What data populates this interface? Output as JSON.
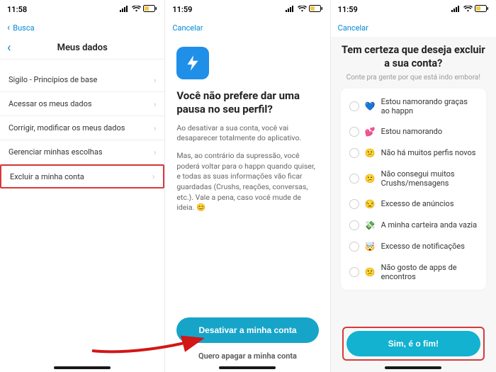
{
  "status": {
    "time1": "11:58",
    "time2": "11:59",
    "time3": "11:59",
    "busca": "Busca"
  },
  "colors": {
    "accent": "#17a4c9",
    "link": "#0088d4",
    "highlight": "#d83a3a"
  },
  "screen1": {
    "title": "Meus dados",
    "rows": [
      {
        "label": "Sigilo - Princípios de base"
      },
      {
        "label": "Acessar os meus dados"
      },
      {
        "label": "Corrigir, modificar os meus dados"
      },
      {
        "label": "Gerenciar minhas escolhas"
      },
      {
        "label": "Excluir a minha conta"
      }
    ]
  },
  "screen2": {
    "cancel": "Cancelar",
    "title": "Você não prefere dar uma pausa no seu perfil?",
    "p1": "Ao desativar a sua conta, você vai desaparecer totalmente do aplicativo.",
    "p2": "Mas, ao contrário da supressão, você poderá voltar para o happn quando quiser, e todas as suas informações vão ficar guardadas (Crushs, reações, conversas, etc.). Vale a pena, caso você mude de ideia. 😊",
    "primary": "Desativar a minha conta",
    "secondary": "Quero apagar a minha conta"
  },
  "screen3": {
    "cancel": "Cancelar",
    "title": "Tem certeza que deseja excluir a sua conta?",
    "subtitle": "Conte pra gente por que está indo embora!",
    "reasons": [
      {
        "emoji": "💙",
        "label": "Estou namorando graças ao happn"
      },
      {
        "emoji": "💕",
        "label": "Estou namorando"
      },
      {
        "emoji": "😕",
        "label": "Não há muitos perfis novos"
      },
      {
        "emoji": "😕",
        "label": "Não consegui muitos Crushs/mensagens"
      },
      {
        "emoji": "😒",
        "label": "Excesso de anúncios"
      },
      {
        "emoji": "💸",
        "label": "A minha carteira anda vazia"
      },
      {
        "emoji": "🤯",
        "label": "Excesso de notificações"
      },
      {
        "emoji": "😕",
        "label": "Não gosto de apps de encontros"
      }
    ],
    "primary": "Sim, é o fim!"
  }
}
